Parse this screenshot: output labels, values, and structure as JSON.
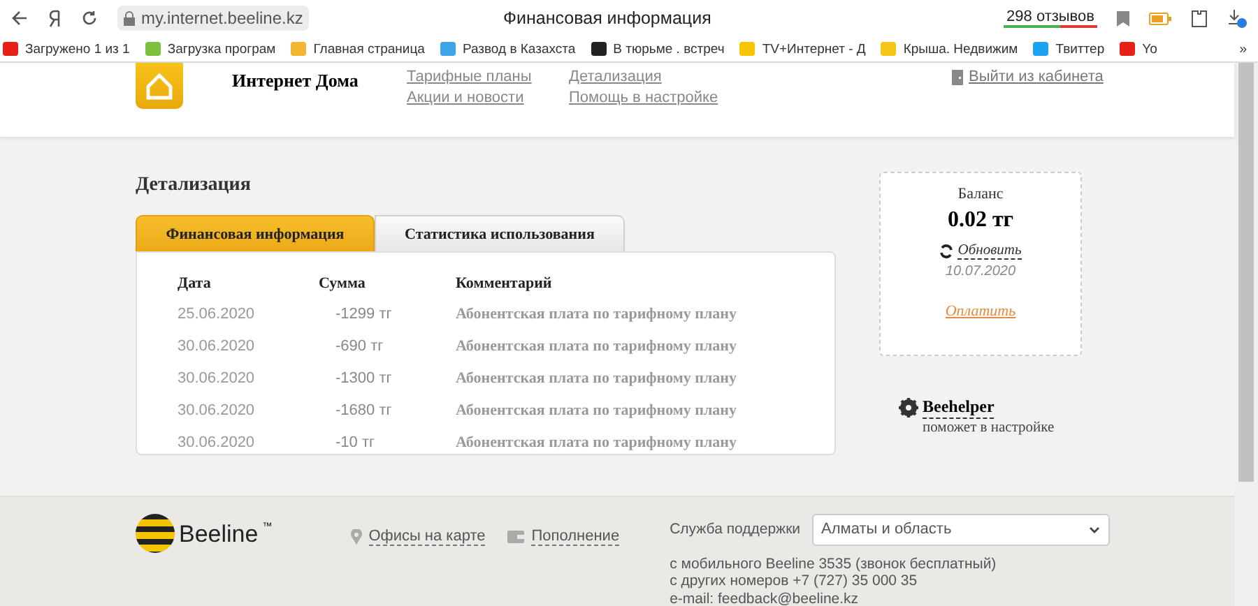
{
  "browser": {
    "address": "my.internet.beeline.kz",
    "page_title": "Финансовая информация",
    "reviews": "298 отзывов",
    "bookmarks": [
      {
        "label": "Загружено 1 из 1",
        "color": "#e62117"
      },
      {
        "label": "Загрузка програм",
        "color": "#7cc13e"
      },
      {
        "label": "Главная страница",
        "color": "#f2b632"
      },
      {
        "label": "Развод в Казахста",
        "color": "#3ea6e8"
      },
      {
        "label": "В тюрьме . встреч",
        "color": "#222222"
      },
      {
        "label": "TV+Интернет - Д",
        "color": "#f6c500"
      },
      {
        "label": "Крыша. Недвижим",
        "color": "#f5c518"
      },
      {
        "label": "Твиттер",
        "color": "#1da1f2"
      },
      {
        "label": "Yo",
        "color": "#e62117"
      }
    ],
    "more": "»"
  },
  "header": {
    "title": "Интернет Дома",
    "nav": [
      {
        "label": "Тарифные планы"
      },
      {
        "label": "Детализация"
      },
      {
        "label": "Акции и новости"
      },
      {
        "label": "Помощь в настройке"
      }
    ],
    "logout": "Выйти из кабинета"
  },
  "detail": {
    "title": "Детализация",
    "tabs": [
      {
        "label": "Финансовая информация",
        "selected": true
      },
      {
        "label": "Статистика использования",
        "selected": false
      }
    ],
    "columns": [
      "Дата",
      "Сумма",
      "Комментарий"
    ],
    "rows": [
      [
        "25.06.2020",
        "-1299 тг",
        "Абонентская плата по тарифному плану"
      ],
      [
        "30.06.2020",
        "-690 тг",
        "Абонентская плата по тарифному плану"
      ],
      [
        "30.06.2020",
        "-1300 тг",
        "Абонентская плата по тарифному плану"
      ],
      [
        "30.06.2020",
        "-1680 тг",
        "Абонентская плата по тарифному плану"
      ],
      [
        "30.06.2020",
        "-10 тг",
        "Абонентская плата по тарифному плану"
      ]
    ]
  },
  "balance": {
    "label": "Баланс",
    "amount": "0.02 тг",
    "refresh": "Обновить",
    "date": "10.07.2020",
    "pay": "Оплатить"
  },
  "helper": {
    "title": "Beehelper",
    "subtitle": "поможет в настройке"
  },
  "footer": {
    "brand": "Beeline",
    "brand_mark": "™",
    "links": [
      {
        "label": "Офисы на карте",
        "kind": "pin"
      },
      {
        "label": "Пополнение",
        "kind": "card"
      }
    ],
    "support_label": "Служба поддержки",
    "region": "Алматы и область",
    "contacts": [
      "с мобильного Beeline 3535 (звонок бесплатный)",
      "с других номеров +7 (727) 35 000 35",
      "e-mail: feedback@beeline.kz"
    ]
  }
}
